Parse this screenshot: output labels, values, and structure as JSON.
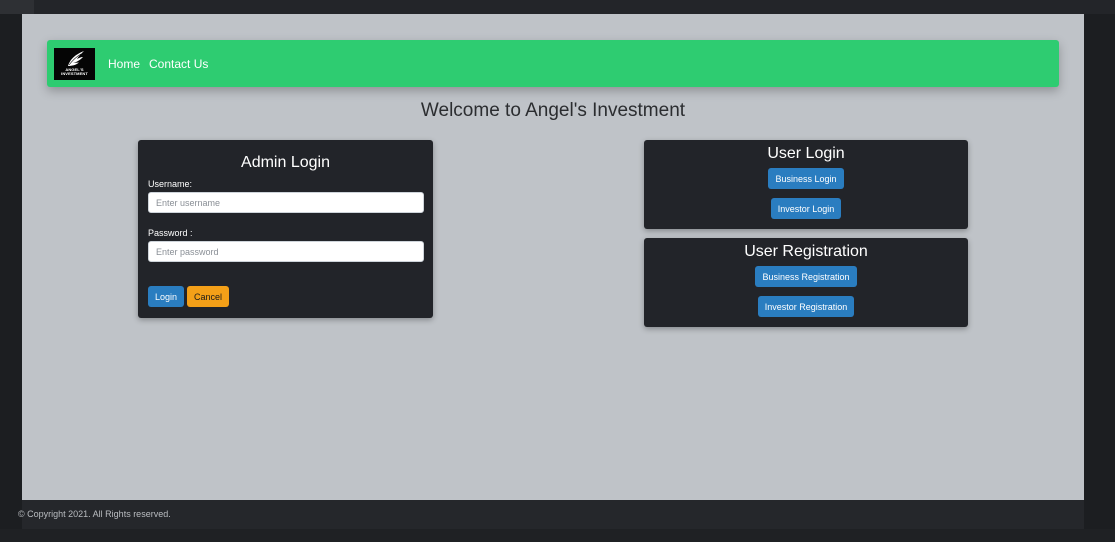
{
  "navbar": {
    "logo_text_line1": "ANGEL'S",
    "logo_text_line2": "INVESTMENT",
    "links": [
      "Home",
      "Contact Us"
    ],
    "color": "#2ecc71"
  },
  "welcome_heading": "Welcome to Angel's Investment",
  "admin_login": {
    "title": "Admin Login",
    "username_label": "Username:",
    "username_placeholder": "Enter username",
    "password_label": "Password :",
    "password_placeholder": "Enter password",
    "login_button": "Login",
    "cancel_button": "Cancel"
  },
  "user_login": {
    "title": "User Login",
    "business_login_button": "Business Login",
    "investor_login_button": "Investor Login"
  },
  "user_registration": {
    "title": "User Registration",
    "business_registration_button": "Business Registration",
    "investor_registration_button": "Investor Registration"
  },
  "footer": {
    "copyright": "© Copyright 2021. All Rights reserved."
  },
  "colors": {
    "button_primary": "#2a7dc0",
    "button_cancel": "#f4a018",
    "card_bg": "#222429",
    "page_bg": "#bfc3c8"
  }
}
